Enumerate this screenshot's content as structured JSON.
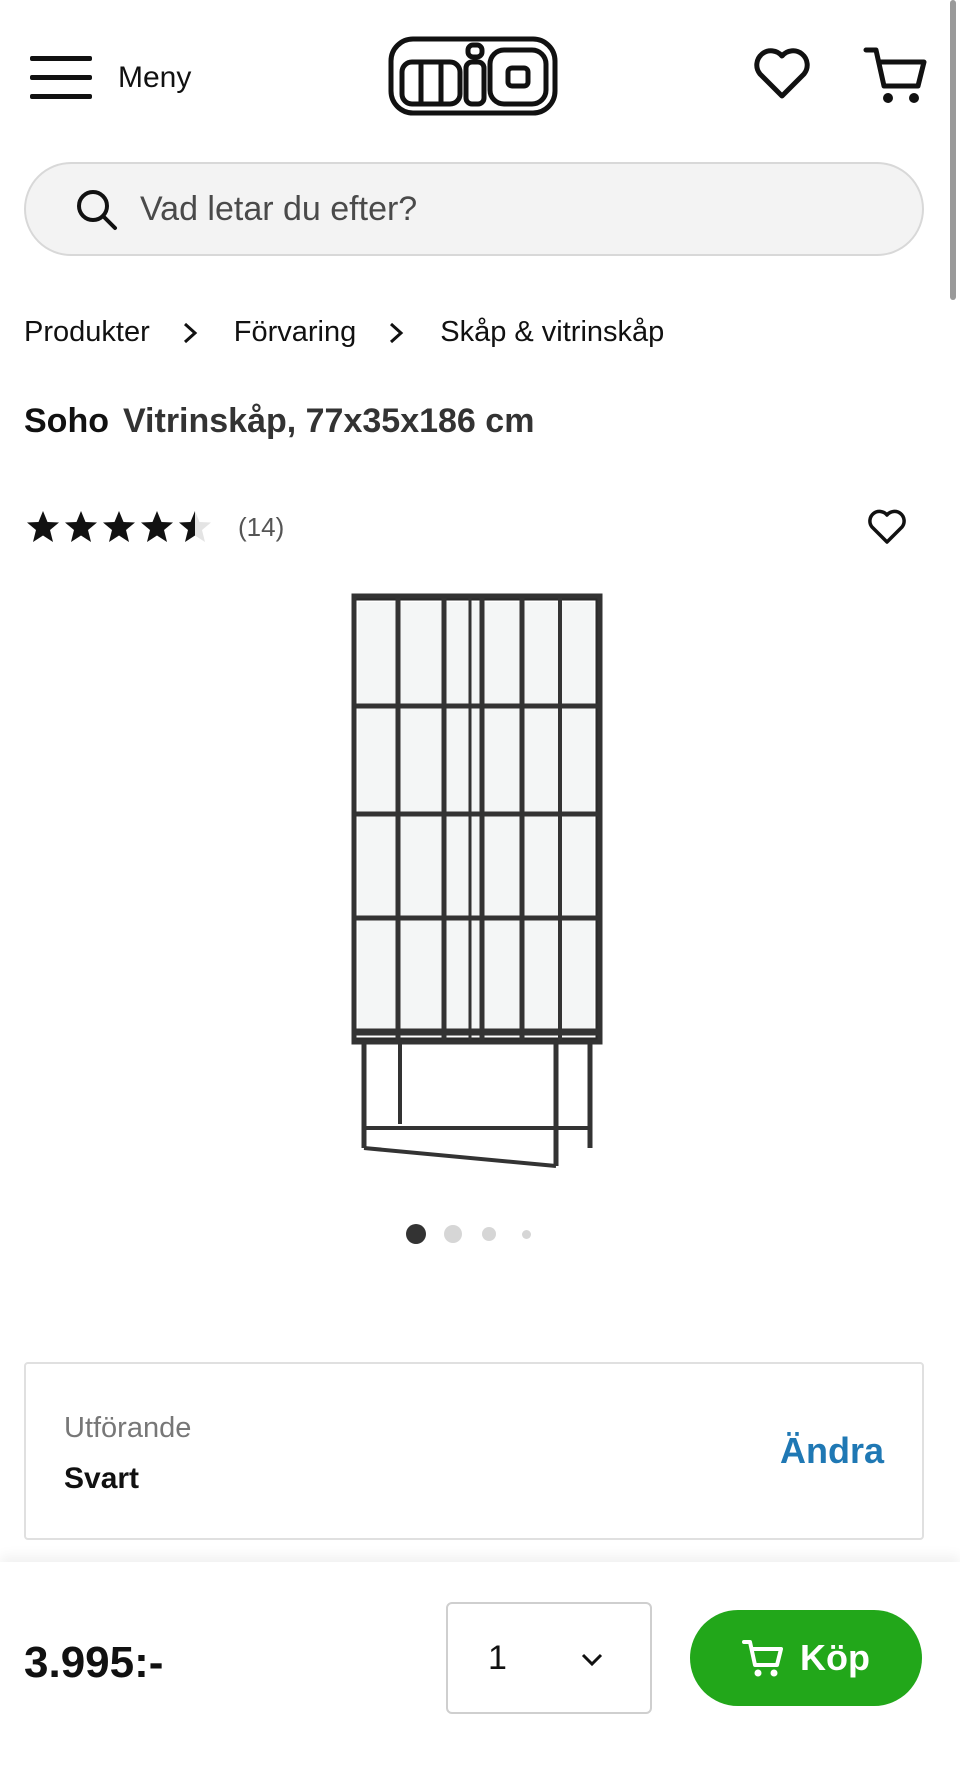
{
  "header": {
    "menu_label": "Meny",
    "logo_text": "MiO"
  },
  "search": {
    "placeholder": "Vad letar du efter?"
  },
  "breadcrumb": [
    "Produkter",
    "Förvaring",
    "Skåp & vitrinskåp"
  ],
  "product": {
    "brand": "Soho",
    "subtitle": "Vitrinskåp, 77x35x186 cm",
    "rating": 4.5,
    "rating_max": 5,
    "review_count": "(14)",
    "image_count": 4,
    "active_image": 1
  },
  "variant": {
    "label": "Utförande",
    "value": "Svart",
    "change_label": "Ändra"
  },
  "buybar": {
    "price": "3.995:-",
    "quantity": "1",
    "buy_label": "Köp"
  },
  "colors": {
    "accent_green": "#22a71a",
    "link_blue": "#1f78b4"
  }
}
